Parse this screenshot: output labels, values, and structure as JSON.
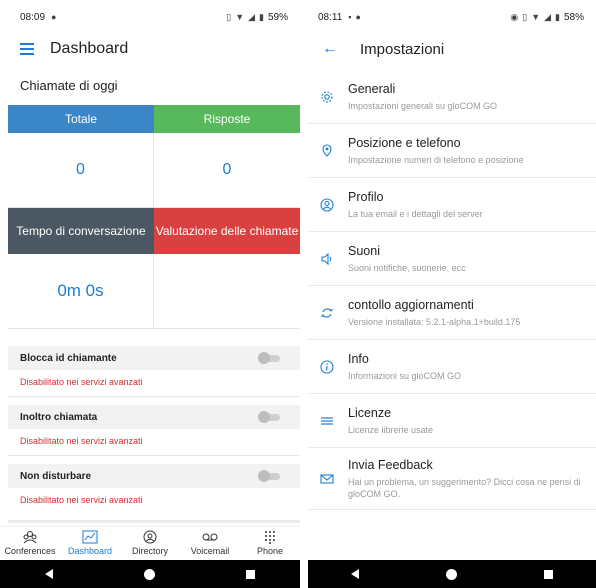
{
  "left": {
    "status": {
      "time": "08:09",
      "battery": "59%"
    },
    "appbar": {
      "title": "Dashboard"
    },
    "subtitle": "Chiamate di oggi",
    "tiles": [
      {
        "label": "Totale",
        "value": "0",
        "color": "#3b86c7"
      },
      {
        "label": "Risposte",
        "value": "0",
        "color": "#58b85c"
      },
      {
        "label": "Tempo di conversazione",
        "value": "0m 0s",
        "color": "#4b5763"
      },
      {
        "label": "Valutazione delle chiamate",
        "value": "",
        "color": "#d94040"
      }
    ],
    "toggles": [
      {
        "label": "Blocca id chiamante",
        "note": "Disabilitato nei servizi avanzati"
      },
      {
        "label": "Inoltro chiamata",
        "note": "Disabilitato nei servizi avanzati"
      },
      {
        "label": "Non disturbare",
        "note": "Disabilitato nei servizi avanzati"
      }
    ],
    "nav": [
      {
        "label": "Conferences",
        "icon": "conferences-icon"
      },
      {
        "label": "Dashboard",
        "icon": "dashboard-icon",
        "active": true
      },
      {
        "label": "Directory",
        "icon": "directory-icon"
      },
      {
        "label": "Voicemail",
        "icon": "voicemail-icon"
      },
      {
        "label": "Phone",
        "icon": "dialpad-icon"
      }
    ]
  },
  "right": {
    "status": {
      "time": "08:11",
      "battery": "58%"
    },
    "appbar": {
      "title": "Impostazioni"
    },
    "items": [
      {
        "title": "Generali",
        "desc": "Impostazioni generali su gloCOM GO",
        "icon": "gear-icon"
      },
      {
        "title": "Posizione e telefono",
        "desc": "Impostazione numeri di telefono e posizione",
        "icon": "location-icon"
      },
      {
        "title": "Profilo",
        "desc": "La tua email e i dettagli del server",
        "icon": "profile-icon"
      },
      {
        "title": "Suoni",
        "desc": "Suoni notifiche, suonerie, ecc",
        "icon": "speaker-icon"
      },
      {
        "title": "contollo aggiornamenti",
        "desc": "Versione installata: 5.2.1-alpha.1+build.175",
        "icon": "refresh-icon"
      },
      {
        "title": "Info",
        "desc": "Informazioni su gloCOM GO",
        "icon": "info-icon"
      },
      {
        "title": "Licenze",
        "desc": "Licenze librerie usate",
        "icon": "list-icon"
      },
      {
        "title": "Invia Feedback",
        "desc": "Hai un problema, un suggerimento? Dicci cosa ne pensi di gloCOM GO.",
        "icon": "mail-icon"
      }
    ]
  }
}
